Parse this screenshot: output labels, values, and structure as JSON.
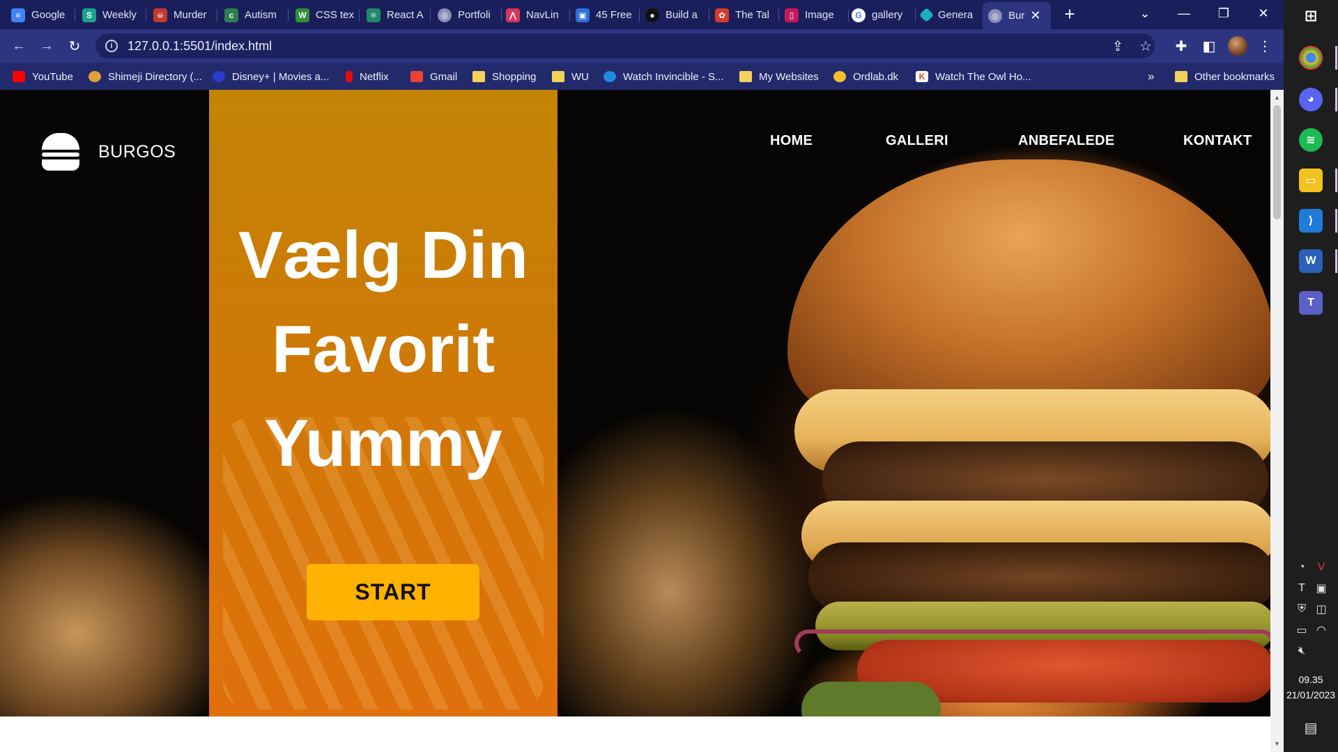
{
  "browser": {
    "tabs": [
      {
        "title": "Google",
        "icon": "google-docs-icon",
        "color": "#4285f4"
      },
      {
        "title": "Weekly",
        "icon": "s-app-icon",
        "color": "#1aa38a"
      },
      {
        "title": "Murder",
        "icon": "mask-icon",
        "color": "#c0392b"
      },
      {
        "title": "Autism",
        "icon": "c-letter-icon",
        "color": "#2e7d4f"
      },
      {
        "title": "CSS tex",
        "icon": "w-letter-icon",
        "color": "#2f8f3a"
      },
      {
        "title": "React A",
        "icon": "react-icon",
        "color": "#1f8a6a"
      },
      {
        "title": "Portfoli",
        "icon": "globe-icon",
        "color": "#8a8fb8"
      },
      {
        "title": "NavLin",
        "icon": "navlink-icon",
        "color": "#d4375b"
      },
      {
        "title": "45 Free",
        "icon": "square-frame-icon",
        "color": "#2f6fd6"
      },
      {
        "title": "Build a",
        "icon": "dark-circle-icon",
        "color": "#111111"
      },
      {
        "title": "The Tal",
        "icon": "red-logo-icon",
        "color": "#d73a2a"
      },
      {
        "title": "Image",
        "icon": "image-tool-icon",
        "color": "#c2185b"
      },
      {
        "title": "gallery",
        "icon": "google-g-icon",
        "color": "#ffffff"
      },
      {
        "title": "Genera",
        "icon": "diamond-icon",
        "color": "#1ab2b8"
      },
      {
        "title": "Bur",
        "icon": "globe-icon",
        "color": "#8a8fb8",
        "active": true
      }
    ],
    "url": "127.0.0.1:5501/index.html",
    "bookmarks": [
      {
        "label": "YouTube",
        "icon": "youtube-icon",
        "color": "#ff0000"
      },
      {
        "label": "Shimeji Directory (...",
        "icon": "shimeji-icon",
        "color": "#e2a23a"
      },
      {
        "label": "Disney+ | Movies a...",
        "icon": "disney-icon",
        "color": "#2b3bd1"
      },
      {
        "label": "Netflix",
        "icon": "netflix-icon",
        "color": "#e50914"
      },
      {
        "label": "Gmail",
        "icon": "gmail-icon",
        "color": "#ea4335"
      },
      {
        "label": "Shopping",
        "icon": "folder-icon",
        "color": "#f4d25a"
      },
      {
        "label": "WU",
        "icon": "folder-icon",
        "color": "#f4d25a"
      },
      {
        "label": "Watch Invincible - S...",
        "icon": "play-icon",
        "color": "#1e88e5"
      },
      {
        "label": "My Websites",
        "icon": "folder-icon",
        "color": "#f4d25a"
      },
      {
        "label": "Ordlab.dk",
        "icon": "speech-bubble-icon",
        "color": "#f2c12e"
      },
      {
        "label": "Watch The Owl Ho...",
        "icon": "k-letter-icon",
        "color": "#ffffff"
      }
    ],
    "more_bookmarks": "»",
    "other_bookmarks": "Other bookmarks"
  },
  "site": {
    "brand": "BURGOS",
    "nav": [
      "HOME",
      "GALLERI",
      "ANBEFALEDE",
      "KONTAKT"
    ],
    "headline": [
      "Vælg Din",
      "Favorit",
      "Yummy"
    ],
    "cta": "START",
    "colors": {
      "overlay": "#e08a08",
      "button": "#ffb200",
      "text": "#ffffff"
    }
  },
  "taskbar": {
    "apps": [
      "windows-start-icon",
      "chrome-icon",
      "discord-icon",
      "spotify-icon",
      "file-explorer-icon",
      "vscode-icon",
      "word-icon",
      "teams-icon"
    ],
    "time": "09.35",
    "date": "21/01/2023"
  }
}
